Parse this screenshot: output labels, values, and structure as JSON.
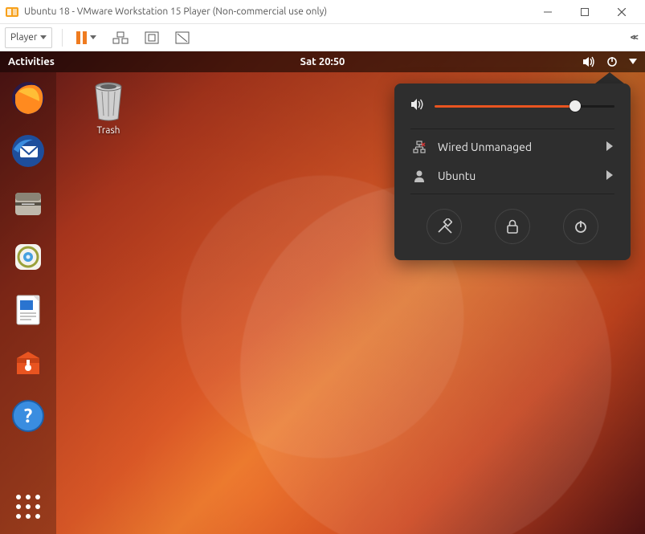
{
  "host_window": {
    "title": "Ubuntu 18 - VMware Workstation 15 Player (Non-commercial use only)",
    "toolbar": {
      "player_label": "Player"
    }
  },
  "guest": {
    "top_panel": {
      "activities": "Activities",
      "clock": "Sat 20:50"
    },
    "desktop": {
      "trash_label": "Trash"
    },
    "popover": {
      "volume_percent": 78,
      "network_label": "Wired Unmanaged",
      "user_label": "Ubuntu"
    }
  }
}
